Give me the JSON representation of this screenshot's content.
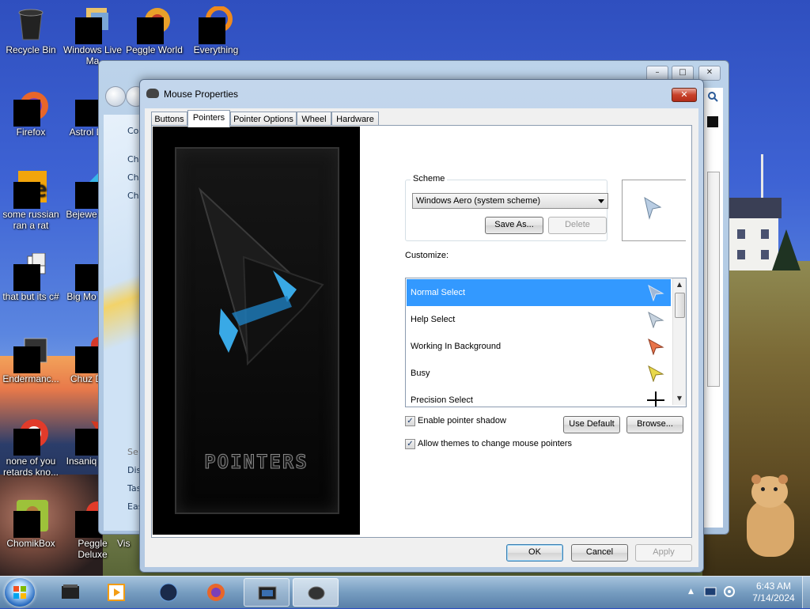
{
  "desktop": {
    "icons": [
      {
        "label": "Recycle Bin",
        "icon": "recycle-bin-icon"
      },
      {
        "label": "Windows Live Ma",
        "icon": "windows-live-icon"
      },
      {
        "label": "Peggle World",
        "icon": "peggle-icon"
      },
      {
        "label": "Everything",
        "icon": "everything-icon"
      },
      {
        "label": "Firefox",
        "icon": "firefox-icon"
      },
      {
        "label": "Astrol Delu",
        "icon": "game-icon"
      },
      {
        "label": "some russian ran a rat",
        "icon": "app-icon"
      },
      {
        "label": "Bejewe Delu",
        "icon": "bejeweled-icon"
      },
      {
        "label": "that but its c#",
        "icon": "app-icon"
      },
      {
        "label": "Big Mo Delu",
        "icon": "game-icon"
      },
      {
        "label": "Endermanc...",
        "icon": "app-icon"
      },
      {
        "label": "Chuz Delu",
        "icon": "game-icon"
      },
      {
        "label": "none of you retards kno...",
        "icon": "app-icon"
      },
      {
        "label": "Insaniq Delu",
        "icon": "game-icon"
      },
      {
        "label": "ChomikBox",
        "icon": "chomikbox-icon"
      },
      {
        "label": "Peggle Deluxe",
        "icon": "peggle-icon"
      },
      {
        "label": "Vis",
        "icon": "app-icon"
      }
    ]
  },
  "background_window": {
    "partial_texts": [
      "Co",
      "Ch",
      "Ch",
      "Ch",
      "Se",
      "Dis",
      "Tas",
      "Eas"
    ]
  },
  "dialog": {
    "title": "Mouse Properties",
    "close_label": "✕",
    "tabs": [
      "Buttons",
      "Pointers",
      "Pointer Options",
      "Wheel",
      "Hardware"
    ],
    "active_tab": "Pointers",
    "preview_logo": "POINTERS",
    "scheme_label": "Scheme",
    "scheme_value": "Windows Aero (system scheme)",
    "save_as_label": "Save As...",
    "delete_label": "Delete",
    "customize_label": "Customize:",
    "cursor_list": [
      {
        "label": "Normal Select",
        "icon": "arrow-cursor-icon",
        "selected": true
      },
      {
        "label": "Help Select",
        "icon": "help-cursor-icon",
        "selected": false
      },
      {
        "label": "Working In Background",
        "icon": "working-cursor-icon",
        "selected": false
      },
      {
        "label": "Busy",
        "icon": "busy-cursor-icon",
        "selected": false
      },
      {
        "label": "Precision Select",
        "icon": "crosshair-cursor-icon",
        "selected": false
      }
    ],
    "enable_shadow_label": "Enable pointer shadow",
    "enable_shadow_checked": true,
    "use_default_label": "Use Default",
    "browse_label": "Browse...",
    "allow_themes_label": "Allow themes to change mouse pointers",
    "allow_themes_checked": true,
    "ok_label": "OK",
    "cancel_label": "Cancel",
    "apply_label": "Apply"
  },
  "taskbar": {
    "pinned": [
      "windows-explorer-icon",
      "media-player-icon",
      "app-icon",
      "firefox-icon",
      "control-panel-icon",
      "mouse-icon"
    ],
    "time": "6:43 AM",
    "date": "7/14/2024"
  },
  "colors": {
    "selection": "#3399ff",
    "cursor_normal": "#9fb8d8",
    "cursor_working": "#e8744a",
    "cursor_busy": "#e8d84a"
  }
}
